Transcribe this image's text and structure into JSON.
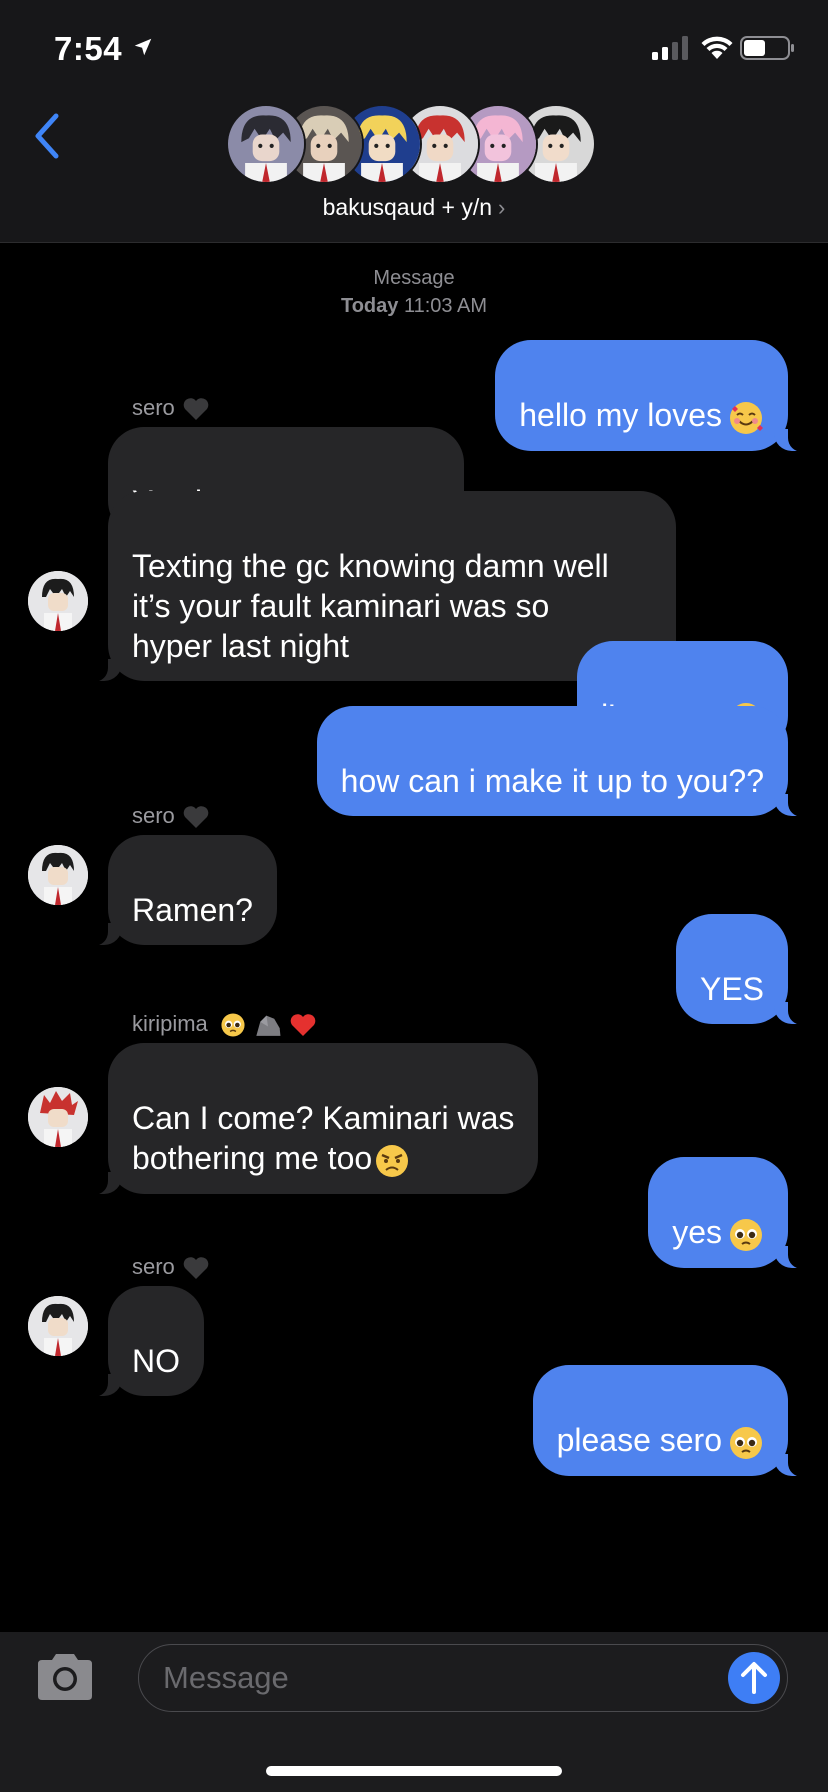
{
  "status_bar": {
    "time": "7:54"
  },
  "header": {
    "group_name": "bakusqaud + y/n",
    "chevron": "›",
    "avatars": [
      {
        "name": "avatar-1",
        "bg": "#8b8ba8",
        "hair": "#2b2b33",
        "skin": "#e9d6cc"
      },
      {
        "name": "avatar-2",
        "bg": "#5a5552",
        "hair": "#d9cdb6",
        "skin": "#e8d1bd"
      },
      {
        "name": "avatar-3",
        "bg": "#1f3e8e",
        "hair": "#f2d25a",
        "skin": "#f1dcc4"
      },
      {
        "name": "avatar-4",
        "bg": "#dcdcdf",
        "hair": "#c8322f",
        "skin": "#f0d9c6"
      },
      {
        "name": "avatar-5",
        "bg": "#b59ac2",
        "hair": "#f4b6d3",
        "skin": "#f2c3dc"
      },
      {
        "name": "avatar-6",
        "bg": "#d8d8d8",
        "hair": "#1a1a1a",
        "skin": "#f1dccb"
      }
    ]
  },
  "thread": {
    "service_label": "Message",
    "timestamp_day": "Today",
    "timestamp_time": "11:03 AM",
    "messages": {
      "m1": {
        "text": "hello my loves",
        "emoji": "smiling-face-with-hearts"
      },
      "s1": {
        "sender": "sero"
      },
      "m2": {
        "text": "You have some nerve"
      },
      "m3": {
        "text": "Texting the gc knowing damn well\nit’s your fault kaminari was so\nhyper last night"
      },
      "m4": {
        "text": "i’m sorry",
        "emoji": "pleading-face"
      },
      "m5": {
        "text": "how can i make it up to you??"
      },
      "s2": {
        "sender": "sero"
      },
      "m6": {
        "text": "Ramen?"
      },
      "m7": {
        "text": "YES"
      },
      "s3": {
        "sender": "kiripima",
        "emojis": [
          "pleading-face",
          "rock",
          "red-heart"
        ]
      },
      "m8": {
        "text": "Can I come? Kaminari was\nbothering me too",
        "emoji": "angry-face"
      },
      "m9": {
        "text": "yes",
        "emoji": "pleading-face"
      },
      "s4": {
        "sender": "sero"
      },
      "m10": {
        "text": "NO"
      },
      "m11": {
        "text": "please sero",
        "emoji": "pleading-face"
      }
    }
  },
  "composer": {
    "placeholder": "Message"
  },
  "colors": {
    "outgoing_bubble": "#4f83ee",
    "incoming_bubble": "#262628",
    "accent": "#3e7ef5",
    "background": "#000000"
  }
}
